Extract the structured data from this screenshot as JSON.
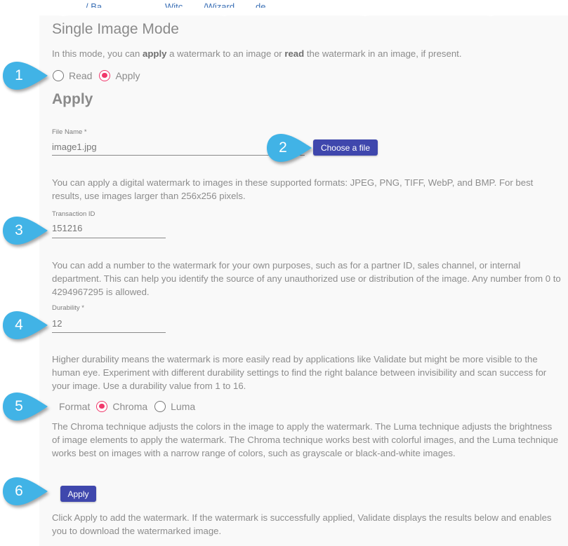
{
  "breadcrumb": {
    "fragments": [
      "/ Ba",
      "Witc",
      "/Wizard",
      "de"
    ]
  },
  "page": {
    "title": "Single Image Mode",
    "intro_prefix": "In this mode, you can ",
    "intro_apply": "apply",
    "intro_mid": " a watermark to an image or ",
    "intro_read": "read",
    "intro_suffix": " the watermark in an image, if present."
  },
  "mode": {
    "options": [
      {
        "label": "Read",
        "checked": false
      },
      {
        "label": "Apply",
        "checked": true
      }
    ]
  },
  "apply_section": {
    "heading": "Apply",
    "file_name": {
      "label": "File Name *",
      "value": "image1.jpg",
      "clear_icon": "×"
    },
    "choose_file_button": "Choose a file",
    "formats_help": "You can apply a digital watermark to images in these supported formats: JPEG, PNG, TIFF, WebP, and BMP. For best results, use images larger than 256x256 pixels.",
    "transaction_id": {
      "label": "Transaction ID",
      "value": "151216"
    },
    "transaction_help": "You can add a number to the watermark for your own purposes, such as for a partner ID, sales channel, or internal department. This can help you identify the source of any unauthorized use or distribution of the image. Any number from 0 to 4294967295 is allowed.",
    "durability": {
      "label": "Durability *",
      "value": "12"
    },
    "durability_help": "Higher durability means the watermark is more easily read by applications like Validate but might be more visible to the human eye. Experiment with different durability settings to find the right balance between invisibility and scan success for your image. Use a durability value from 1 to 16.",
    "format": {
      "label": "Format",
      "options": [
        {
          "label": "Chroma",
          "checked": true
        },
        {
          "label": "Luma",
          "checked": false
        }
      ]
    },
    "format_help": "The Chroma technique adjusts the colors in the image to apply the watermark. The Luma technique adjusts the brightness of image elements to apply the watermark. The Chroma technique works best with colorful images, and the Luma technique works best on images with a narrow range of colors, such as grayscale or black-and-white images.",
    "apply_button": "Apply",
    "apply_help": "Click Apply to add the watermark. If the watermark is successfully applied, Validate displays the results below and enables you to download the watermarked image."
  },
  "callouts": [
    "1",
    "2",
    "3",
    "4",
    "5",
    "6"
  ],
  "colors": {
    "accent_radio": "#f0386b",
    "primary_button": "#3f47ad",
    "callout": "#41b3e6",
    "panel_bg": "#f9f9f9"
  }
}
